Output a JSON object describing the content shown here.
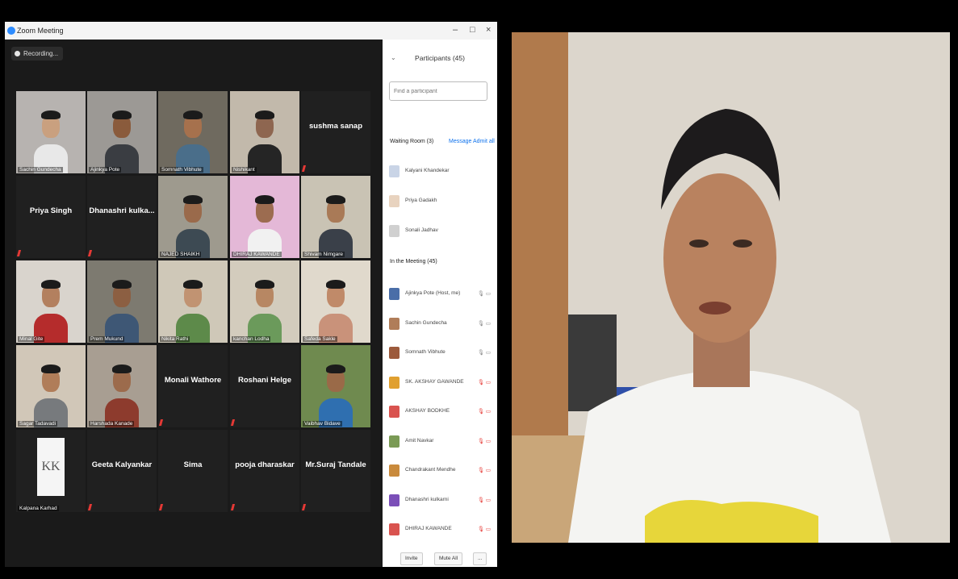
{
  "window": {
    "title": "Zoom Meeting",
    "minimize": "–",
    "maximize": "□",
    "close": "×"
  },
  "recording": "Recording...",
  "tiles": [
    {
      "name": "Sachin Gundecha",
      "type": "video",
      "skin": "#c9a07f",
      "shirt": "#e8e8e8",
      "bg": "#b7b3b0"
    },
    {
      "name": "Ajinkya Pote",
      "type": "video",
      "skin": "#8a5b3c",
      "shirt": "#3a3d42",
      "bg": "#9c9995"
    },
    {
      "name": "Somnath Vibhute",
      "type": "video",
      "active": true,
      "skin": "#a6714d",
      "shirt": "#4a6e8a",
      "bg": "#6f6a5f"
    },
    {
      "name": "Nishikant",
      "type": "video",
      "skin": "#8e6650",
      "shirt": "#252525",
      "bg": "#c2b9ab"
    },
    {
      "name": "sushma sanap",
      "type": "name"
    },
    {
      "name": "Priya Singh",
      "type": "name"
    },
    {
      "name": "Dhanashri kulka...",
      "type": "name"
    },
    {
      "name": "NAJED SHAIKH",
      "type": "video",
      "skin": "#9a6a4b",
      "shirt": "#3d4a53",
      "bg": "#9e9a8e"
    },
    {
      "name": "DHIRAJ KAWANDE",
      "type": "video",
      "skin": "#9c6c50",
      "shirt": "#f1f1f1",
      "bg": "#e4b8d7"
    },
    {
      "name": "Shivam Nimgare",
      "type": "video",
      "skin": "#a97a57",
      "shirt": "#3a4049",
      "bg": "#c9c3b4"
    },
    {
      "name": "Minal Gite",
      "type": "video",
      "skin": "#b3805f",
      "shirt": "#b52c2c",
      "bg": "#d9d4cd"
    },
    {
      "name": "Prem Mukund",
      "type": "video",
      "skin": "#8c5f42",
      "shirt": "#3e5775",
      "bg": "#7d7a70"
    },
    {
      "name": "Nikita Rathi",
      "type": "video",
      "skin": "#c19372",
      "shirt": "#5d8a4a",
      "bg": "#cfc8b8"
    },
    {
      "name": "kanchan Lodha",
      "type": "video",
      "skin": "#b78763",
      "shirt": "#6b9a5b",
      "bg": "#d3ccbd"
    },
    {
      "name": "Safeda Sakle",
      "type": "video",
      "skin": "#c08a69",
      "shirt": "#c9927a",
      "bg": "#e0d9cc"
    },
    {
      "name": "Sagar Tadavadi",
      "type": "video",
      "skin": "#b07d59",
      "shirt": "#777a7d",
      "bg": "#d1c7b8"
    },
    {
      "name": "Harshada Kanade",
      "type": "video",
      "skin": "#9c6b4c",
      "shirt": "#8d3b2d",
      "bg": "#a89e92"
    },
    {
      "name": "Monali Wathore",
      "type": "name"
    },
    {
      "name": "Roshani Helge",
      "type": "name"
    },
    {
      "name": "Vaibhav Bidave",
      "type": "video",
      "skin": "#9a6a48",
      "shirt": "#2f6fb0",
      "bg": "#6f8a4f"
    },
    {
      "name": "Kalpana Karhad",
      "type": "logo",
      "logo": "KK"
    },
    {
      "name": "Geeta Kalyankar",
      "type": "name"
    },
    {
      "name": "Sima",
      "type": "name"
    },
    {
      "name": "pooja dharaskar",
      "type": "name"
    },
    {
      "name": "Mr.Suraj Tandale",
      "type": "name"
    }
  ],
  "participants": {
    "title": "Participants (45)",
    "search_placeholder": "Find a participant",
    "waiting_room": {
      "label": "Waiting Room (3)",
      "message": "Message",
      "admit_all": "Admit all",
      "people": [
        {
          "name": "Kalyani Khandekar",
          "avatar_color": "#c9d4e6"
        },
        {
          "name": "Priya Gadakh",
          "avatar_color": "#e8d3bf"
        },
        {
          "name": "Sonali Jadhav",
          "avatar_color": "#d0d0d0"
        }
      ]
    },
    "in_meeting": {
      "label": "In the Meeting (45)",
      "people": [
        {
          "name": "Ajinkya Pote (Host, me)",
          "avatar_color": "#4a6ea8",
          "status": "🎙 ▭",
          "muted": false
        },
        {
          "name": "Sachin Gundecha",
          "avatar_color": "#b07d59",
          "status": "🎙 ▭",
          "muted": false
        },
        {
          "name": "Somnath Vibhute",
          "avatar_color": "#9c5a3c",
          "status": "🎙 ▭",
          "muted": false
        },
        {
          "name": "SK. AKSHAY GAWANDE",
          "avatar_color": "#e0a030",
          "status": "🎙 ▭",
          "muted": true
        },
        {
          "name": "AKSHAY BODKHE",
          "avatar_color": "#d9534f",
          "status": "🎙 ▭",
          "muted": true
        },
        {
          "name": "Amit Navkar",
          "avatar_color": "#7a9a55",
          "status": "🎙 ▭",
          "muted": true
        },
        {
          "name": "Chandrakant Mendhe",
          "avatar_color": "#c98a3c",
          "status": "🎙 ▭",
          "muted": true
        },
        {
          "name": "Dhanashri kulkarni",
          "avatar_color": "#7b4fb8",
          "status": "🎙 ▭",
          "muted": true
        },
        {
          "name": "DHIRAJ KAWANDE",
          "avatar_color": "#d9534f",
          "status": "🎙 ▭",
          "muted": true
        }
      ]
    },
    "invite": "Invite",
    "mute_all": "Mute All",
    "more": "..."
  }
}
